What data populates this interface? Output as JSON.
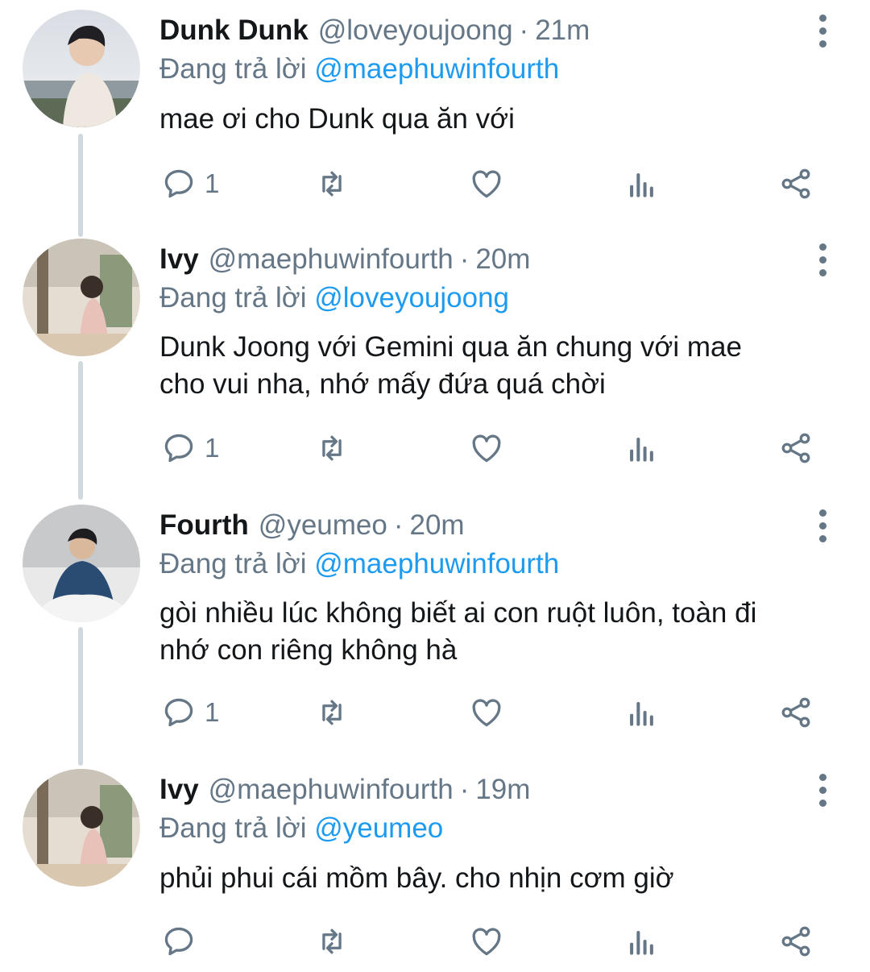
{
  "tweets": [
    {
      "name": "Dunk Dunk",
      "handle": "@loveyoujoong",
      "time": "21m",
      "reply_prefix": "Đang trả lời",
      "reply_to": "@maephuwinfourth",
      "text": "mae ơi cho Dunk qua ăn với",
      "reply_count": "1"
    },
    {
      "name": "Ivy",
      "handle": "@maephuwinfourth",
      "time": "20m",
      "reply_prefix": "Đang trả lời",
      "reply_to": "@loveyoujoong",
      "text_lines": [
        "Dunk Joong với Gemini qua ăn chung với mae",
        "cho vui nha, nhớ mấy đứa quá chời"
      ],
      "reply_count": "1"
    },
    {
      "name": "Fourth",
      "handle": "@yeumeo",
      "time": "20m",
      "reply_prefix": "Đang trả lời",
      "reply_to": "@maephuwinfourth",
      "text_lines": [
        "gòi nhiều lúc không biết ai con ruột luôn, toàn đi",
        "nhớ con riêng không hà"
      ],
      "reply_count": "1"
    },
    {
      "name": "Ivy",
      "handle": "@maephuwinfourth",
      "time": "19m",
      "reply_prefix": "Đang trả lời",
      "reply_to": "@yeumeo",
      "text": "phủi phui cái mồm bây. cho nhịn cơm giờ",
      "reply_count": ""
    }
  ],
  "separator": "·",
  "icons": [
    "reply-icon",
    "retweet-icon",
    "like-icon",
    "analytics-icon",
    "share-icon",
    "more-icon"
  ],
  "colors": {
    "link": "#1d9bf0",
    "secondary": "#657786",
    "thread_line": "#cfd9de"
  }
}
